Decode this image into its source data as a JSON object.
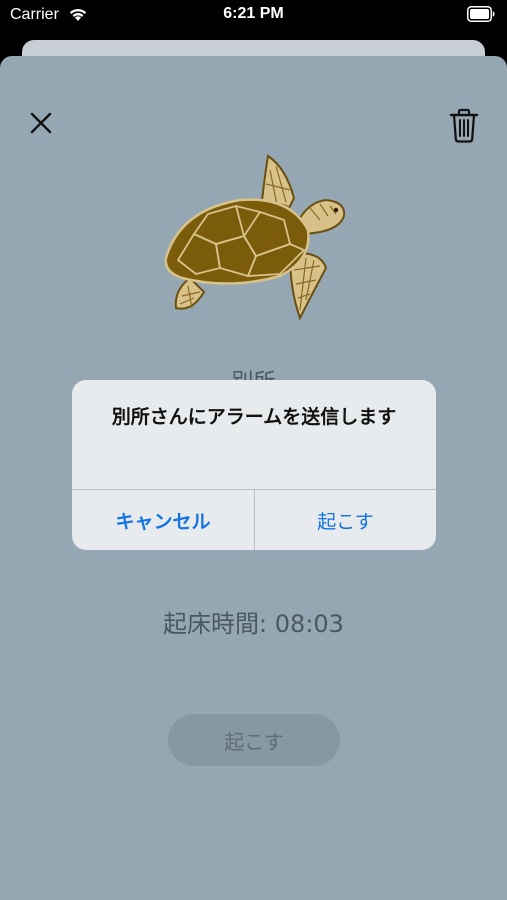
{
  "status_bar": {
    "carrier": "Carrier",
    "time": "6:21 PM"
  },
  "sheet": {
    "name_label": "別所",
    "wake_time": "起床時間: 08:03",
    "wake_button_label": "起こす"
  },
  "alert": {
    "message": "別所さんにアラームを送信します",
    "cancel_label": "キャンセル",
    "confirm_label": "起こす"
  },
  "icons": {
    "close": "close-icon",
    "trash": "trash-icon",
    "turtle": "sea-turtle-icon",
    "wifi": "wifi-icon",
    "battery": "battery-icon"
  },
  "colors": {
    "sheet_background": "#94a7b2",
    "alert_background": "#e7ebee",
    "accent_blue": "#1274e5",
    "turtle_shell": "#7a5c0a"
  }
}
